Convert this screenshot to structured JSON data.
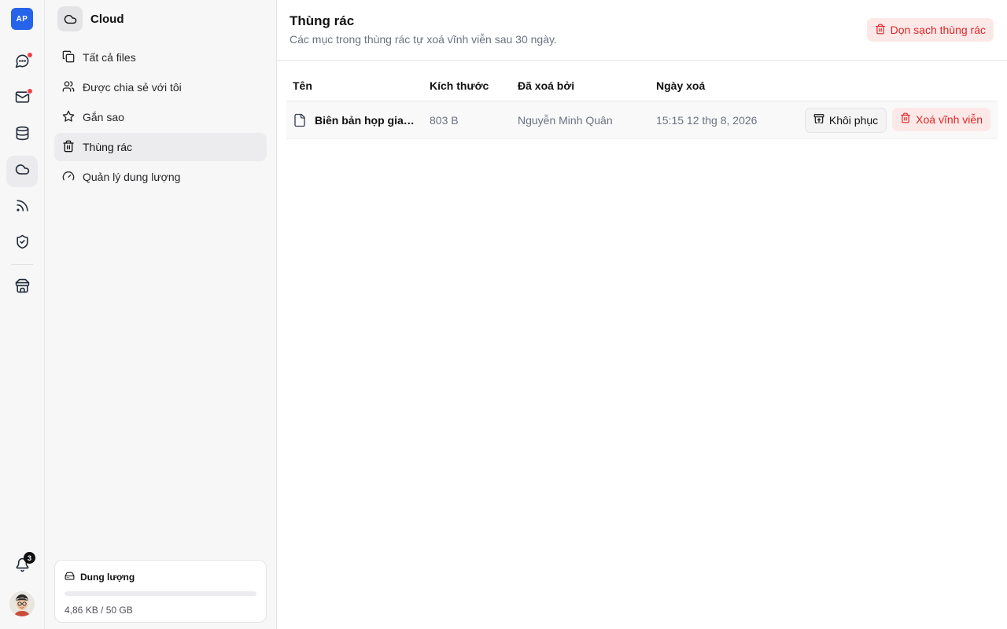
{
  "rail": {
    "logo_text": "AP",
    "items": [
      {
        "name": "chat",
        "icon": "chat-icon",
        "has_dot": true
      },
      {
        "name": "mail",
        "icon": "mail-icon",
        "has_dot": true
      },
      {
        "name": "database",
        "icon": "database-icon",
        "has_dot": false
      },
      {
        "name": "cloud",
        "icon": "cloud-icon",
        "has_dot": false,
        "active": true
      },
      {
        "name": "rss",
        "icon": "rss-icon",
        "has_dot": false
      },
      {
        "name": "shield",
        "icon": "shield-check-icon",
        "has_dot": false
      },
      {
        "name": "store",
        "icon": "store-icon",
        "has_dot": false
      }
    ],
    "notification_count": "3",
    "notification_icon": "bell-icon",
    "avatar_icon": "avatar-icon"
  },
  "sidebar": {
    "title": "Cloud",
    "title_icon": "cloud-icon",
    "items": [
      {
        "label": "Tất cả files",
        "icon": "files-icon",
        "active": false
      },
      {
        "label": "Được chia sẻ với tôi",
        "icon": "users-icon",
        "active": false
      },
      {
        "label": "Gắn sao",
        "icon": "star-icon",
        "active": false
      },
      {
        "label": "Thùng rác",
        "icon": "trash-icon",
        "active": true
      },
      {
        "label": "Quản lý dung lượng",
        "icon": "gauge-icon",
        "active": false
      }
    ],
    "storage": {
      "label": "Dung lượng",
      "icon": "hard-drive-icon",
      "usage_text": "4,86 KB / 50 GB",
      "used_fraction": 1e-07
    }
  },
  "main": {
    "title": "Thùng rác",
    "subtitle": "Các mục trong thùng rác tự xoá vĩnh viễn sau 30 ngày.",
    "empty_trash_label": "Dọn sạch thùng rác",
    "columns": {
      "name": "Tên",
      "size": "Kích thước",
      "deleted_by": "Đã xoá bởi",
      "deleted_at": "Ngày xoá"
    },
    "rows": [
      {
        "name": "Biên bản họp giao ...",
        "size": "803 B",
        "deleted_by": "Nguyễn Minh Quân",
        "deleted_at": "15:15 12 thg 8, 2026",
        "restore_label": "Khôi phục",
        "delete_label": "Xoá vĩnh viễn"
      }
    ]
  },
  "colors": {
    "accent": "#2563eb",
    "danger": "#dc2626",
    "danger_bg": "#fde8e8",
    "dot": "#ef4444"
  }
}
